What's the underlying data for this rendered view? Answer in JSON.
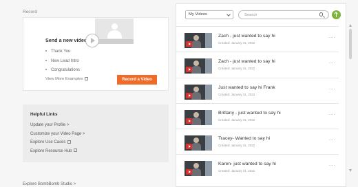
{
  "record_section": {
    "title": "Record",
    "heading": "Send a new video",
    "bullets": [
      "Thank You",
      "New Lead Intro",
      "Congratulations"
    ],
    "more_examples": "View More Examples",
    "record_button": "Record a Video"
  },
  "helpful_links": {
    "heading": "Helpful Links",
    "links": [
      "Update your Profile >",
      "Customize your Video Page >",
      "Explore Use Cases",
      "Explore Resource Hub"
    ]
  },
  "footer_cut": "Explore BombBomb Studio >",
  "videos_panel": {
    "filter_value": "My Videos",
    "search_placeholder": "Search",
    "items": [
      {
        "title": "Zach - just wanted to say hi",
        "date": "Created: January 31, 2022"
      },
      {
        "title": "Zach - just wanted to say hi",
        "date": "Created: January 31, 2022"
      },
      {
        "title": "Just wanted to say hi Frank",
        "date": "Created: January 31, 2022"
      },
      {
        "title": "Brittany - just wanted to say hi",
        "date": "Created: January 31, 2022"
      },
      {
        "title": "Tracey- Wanted to say hi",
        "date": "Created: January 31, 2022"
      },
      {
        "title": "Karen- just wanted to say hi",
        "date": "Created: January 31, 2022"
      }
    ]
  },
  "colors": {
    "record_button": "#f06a28",
    "upload_button": "#7bb53b"
  }
}
